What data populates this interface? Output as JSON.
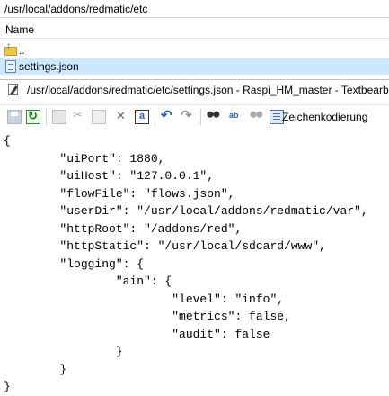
{
  "browser": {
    "path": "/usr/local/addons/redmatic/etc",
    "column_name": "Name",
    "files": [
      {
        "name": "..",
        "icon": "folder-up-icon",
        "selected": false
      },
      {
        "name": "settings.json",
        "icon": "json-file-icon",
        "selected": true
      }
    ]
  },
  "editor": {
    "title": "/usr/local/addons/redmatic/etc/settings.json - Raspi_HM_master - Textbearbeitung",
    "toolbar": {
      "encoding_label": "Zeichenkodierung",
      "icons": [
        "save-icon",
        "reload-icon",
        "copy-icon",
        "cut-icon",
        "paste-icon",
        "delete-icon",
        "select-all-icon",
        "undo-icon",
        "redo-icon",
        "find-icon",
        "replace-icon",
        "find-next-icon",
        "list-icon"
      ]
    },
    "lines": [
      "{",
      "        \"uiPort\": 1880,",
      "        \"uiHost\": \"127.0.0.1\",",
      "        \"flowFile\": \"flows.json\",",
      "        \"userDir\": \"/usr/local/addons/redmatic/var\",",
      "        \"httpRoot\": \"/addons/red\",",
      "        \"httpStatic\": \"/usr/local/sdcard/www\",",
      "        \"logging\": {",
      "                \"ain\": {",
      "                        \"level\": \"info\",",
      "                        \"metrics\": false,",
      "                        \"audit\": false",
      "                }",
      "        }",
      "}"
    ]
  }
}
